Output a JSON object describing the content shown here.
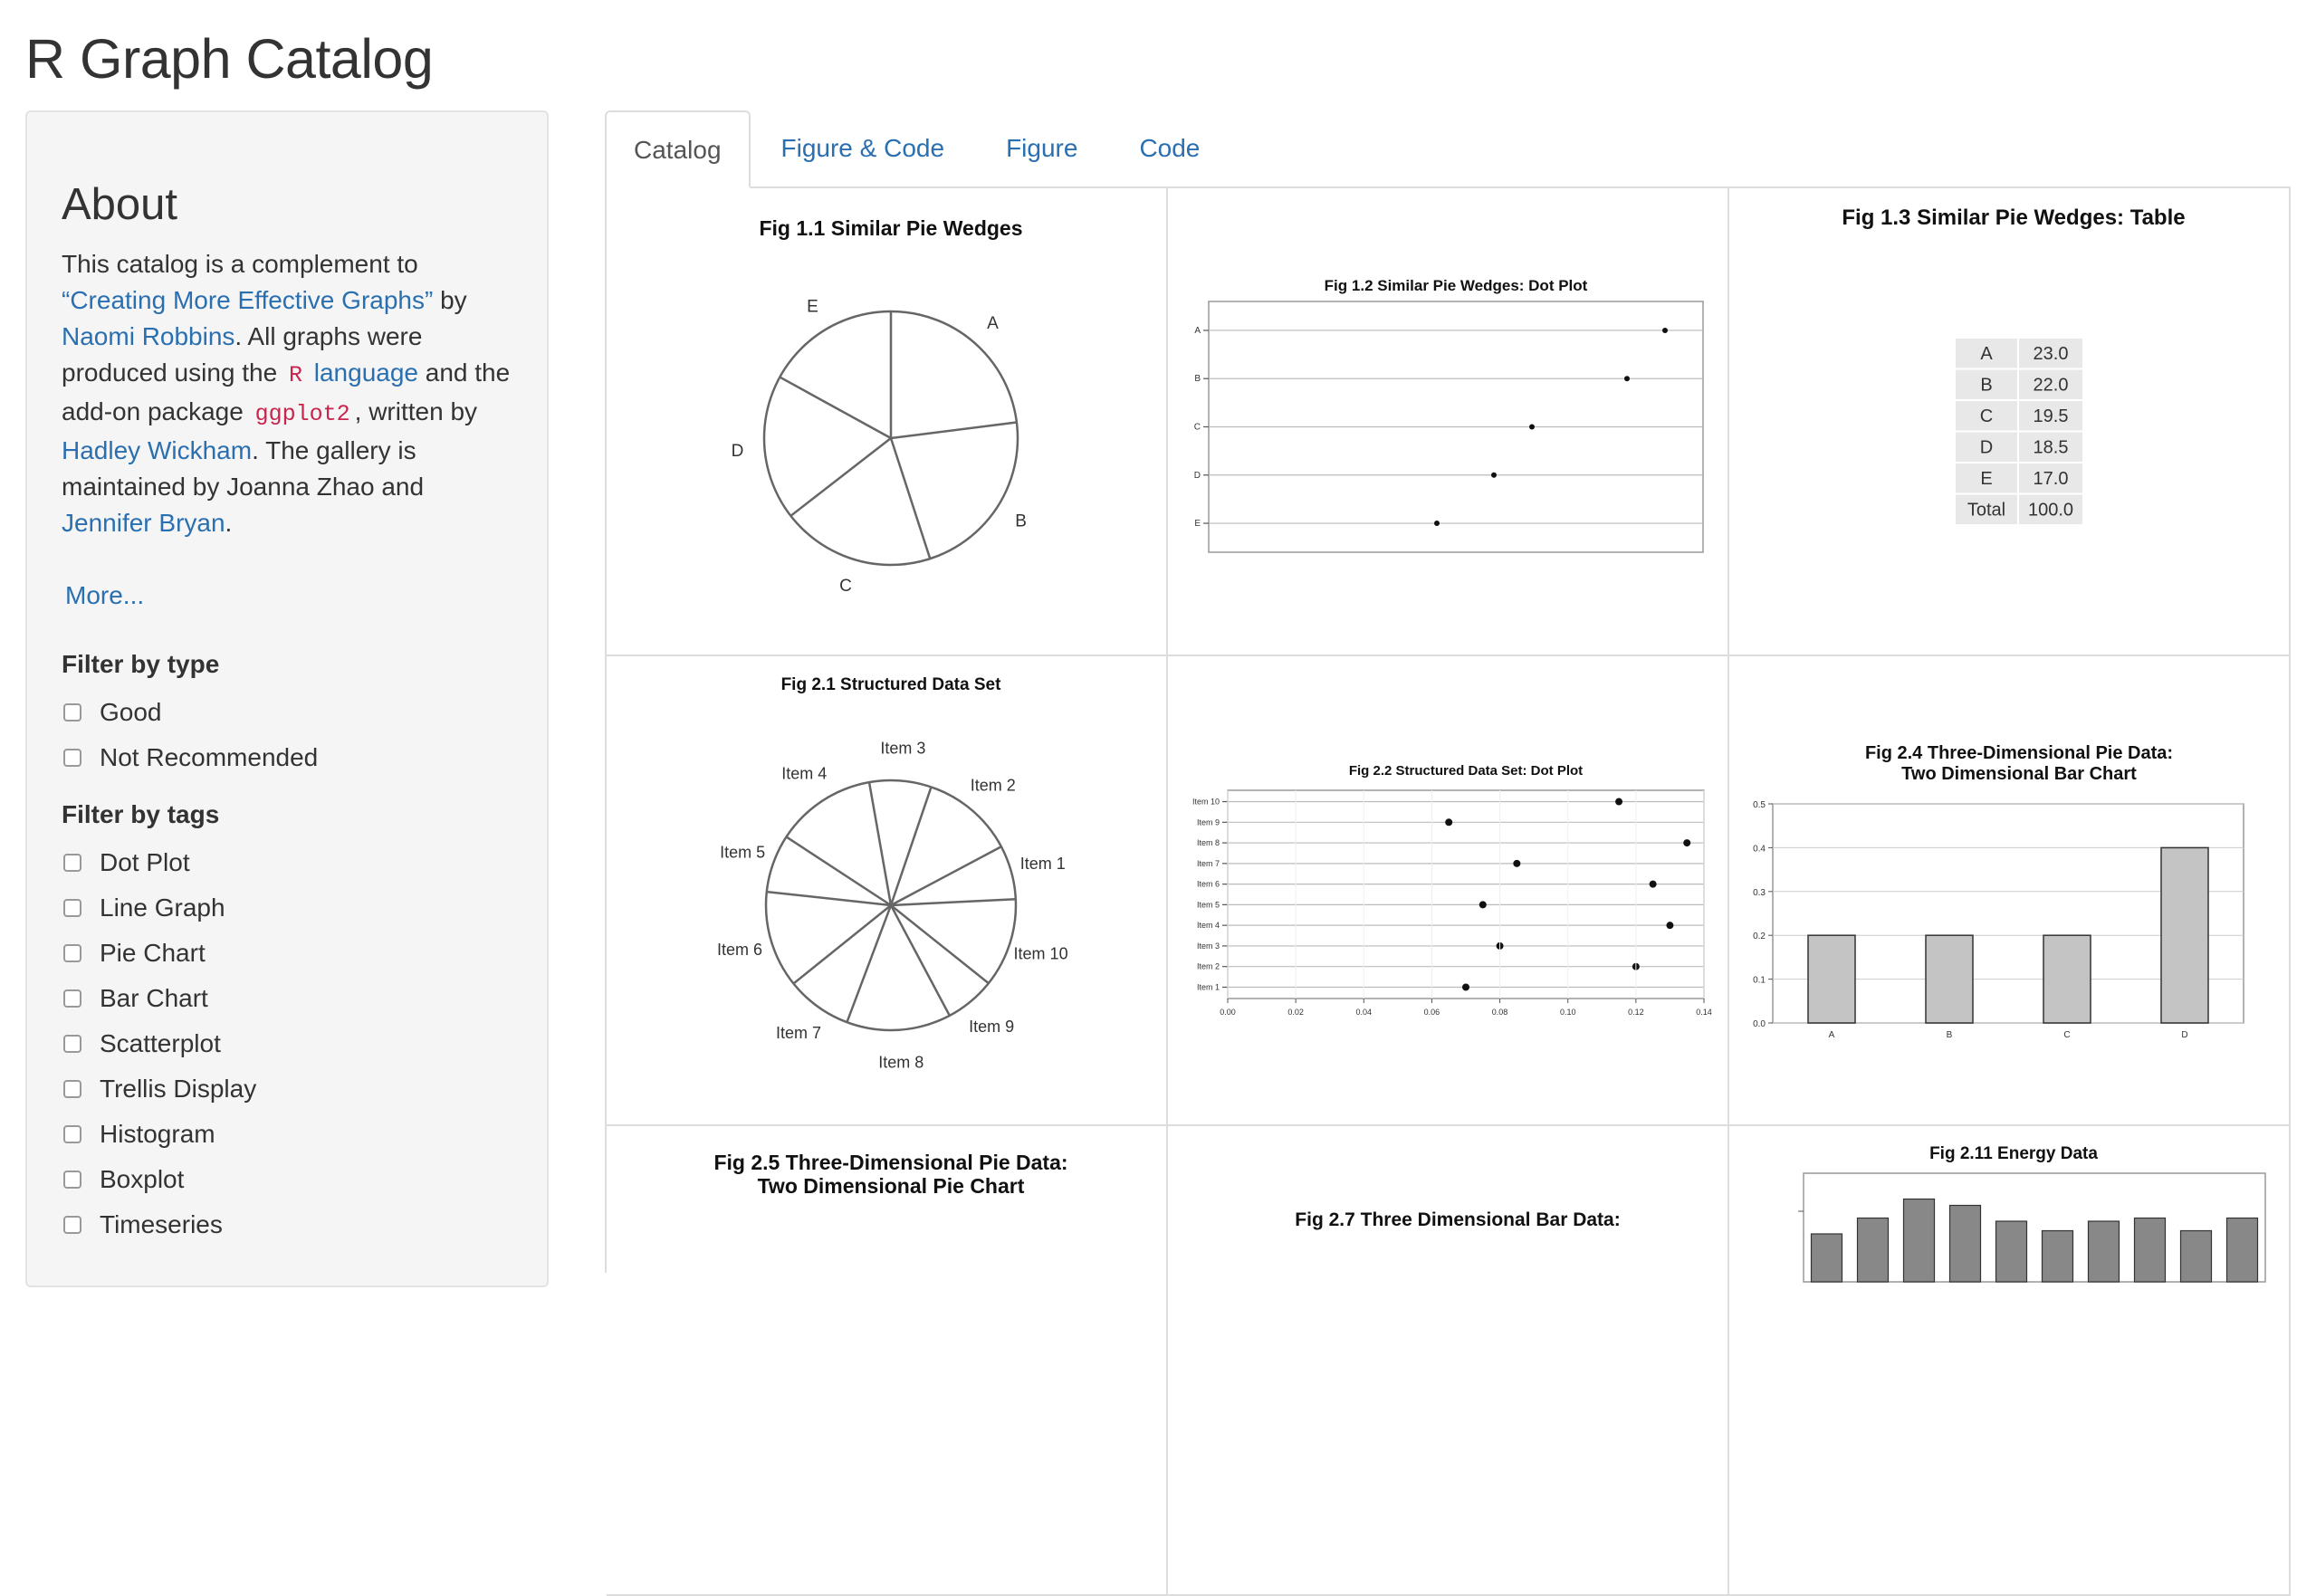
{
  "app": {
    "title": "R Graph Catalog"
  },
  "sidebar": {
    "about_heading": "About",
    "about": {
      "t1": "This catalog is a complement to ",
      "book_link": "“Creating More Effective Graphs”",
      "t2": " by ",
      "author_link": "Naomi Robbins",
      "t3": ". All graphs were produced using the ",
      "code_r": "R",
      "r_link": "language",
      "t4": " and the add-on package ",
      "code_ggplot": "ggplot2",
      "t5": ", written by ",
      "hadley_link": "Hadley Wickham",
      "t6": ". The gallery is maintained by Joanna Zhao and ",
      "jenny_link": "Jennifer Bryan",
      "t7": "."
    },
    "more_link": "More...",
    "filter_type_label": "Filter by type",
    "type_options": [
      "Good",
      "Not Recommended"
    ],
    "filter_tags_label": "Filter by tags",
    "tag_options": [
      "Dot Plot",
      "Line Graph",
      "Pie Chart",
      "Bar Chart",
      "Scatterplot",
      "Trellis Display",
      "Histogram",
      "Boxplot",
      "Timeseries"
    ]
  },
  "tabs": [
    "Catalog",
    "Figure & Code",
    "Figure",
    "Code"
  ],
  "active_tab": "Catalog",
  "figures": {
    "fig11": {
      "title": "Fig 1.1 Similar Pie Wedges",
      "chart_data": {
        "type": "pie",
        "labels": [
          "A",
          "B",
          "C",
          "D",
          "E"
        ],
        "values": [
          23.0,
          22.0,
          19.5,
          18.5,
          17.0
        ]
      }
    },
    "fig12": {
      "title": "Fig 1.2 Similar Pie Wedges: Dot Plot",
      "chart_data": {
        "type": "scatter",
        "categories": [
          "A",
          "B",
          "C",
          "D",
          "E"
        ],
        "values": [
          23.0,
          22.0,
          19.5,
          18.5,
          17.0
        ]
      }
    },
    "fig13": {
      "title": "Fig 1.3 Similar Pie Wedges: Table",
      "chart_data": {
        "type": "table",
        "rows": [
          [
            "A",
            "23.0"
          ],
          [
            "B",
            "22.0"
          ],
          [
            "C",
            "19.5"
          ],
          [
            "D",
            "18.5"
          ],
          [
            "E",
            "17.0"
          ],
          [
            "Total",
            "100.0"
          ]
        ]
      }
    },
    "fig21": {
      "title": "Fig 2.1 Structured Data Set",
      "chart_data": {
        "type": "pie",
        "labels": [
          "Item 1",
          "Item 2",
          "Item 3",
          "Item 4",
          "Item 5",
          "Item 6",
          "Item 7",
          "Item 8",
          "Item 9",
          "Item 10"
        ],
        "values": [
          0.07,
          0.12,
          0.08,
          0.13,
          0.075,
          0.125,
          0.085,
          0.135,
          0.065,
          0.115
        ]
      }
    },
    "fig22": {
      "title": "Fig 2.2 Structured Data Set: Dot Plot",
      "chart_data": {
        "type": "scatter",
        "categories": [
          "Item 10",
          "Item 9",
          "Item 8",
          "Item 7",
          "Item 6",
          "Item 5",
          "Item 4",
          "Item 3",
          "Item 2",
          "Item 1"
        ],
        "values": [
          0.115,
          0.065,
          0.135,
          0.085,
          0.125,
          0.075,
          0.13,
          0.08,
          0.12,
          0.07
        ],
        "xticks": [
          "0.00",
          "0.02",
          "0.04",
          "0.06",
          "0.08",
          "0.10",
          "0.12",
          "0.14"
        ],
        "xlim": [
          0,
          0.14
        ]
      }
    },
    "fig24": {
      "title_line1": "Fig 2.4 Three-Dimensional Pie Data:",
      "title_line2": "Two Dimensional Bar Chart",
      "chart_data": {
        "type": "bar",
        "categories": [
          "A",
          "B",
          "C",
          "D"
        ],
        "values": [
          0.2,
          0.2,
          0.2,
          0.4
        ],
        "yticks": [
          "0.0",
          "0.1",
          "0.2",
          "0.3",
          "0.4",
          "0.5"
        ],
        "ylim": [
          0,
          0.5
        ]
      }
    },
    "fig25": {
      "title_line1": "Fig 2.5 Three-Dimensional Pie Data:",
      "title_line2": "Two Dimensional Pie Chart"
    },
    "fig27": {
      "title": "Fig 2.7 Three Dimensional Bar Data:"
    },
    "fig211": {
      "title": "Fig 2.11 Energy Data",
      "chart_data": {
        "type": "bar",
        "values": [
          0.3,
          0.55,
          0.85,
          0.75,
          0.5,
          0.35,
          0.5,
          0.55,
          0.35,
          0.55
        ]
      }
    }
  }
}
